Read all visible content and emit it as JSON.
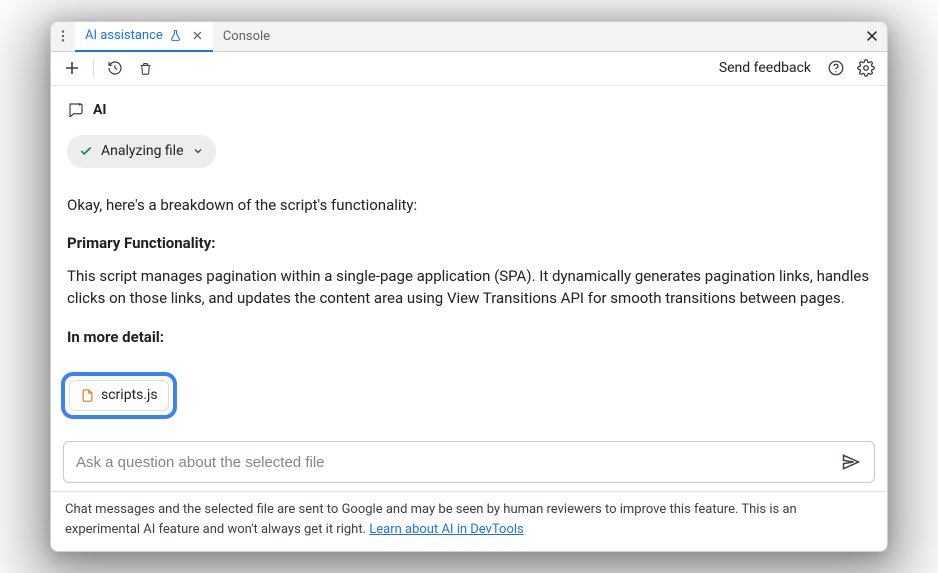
{
  "tabs": {
    "ai_assistance": "AI assistance",
    "console": "Console"
  },
  "toolbar": {
    "send_feedback": "Send feedback"
  },
  "ai": {
    "label": "AI",
    "status": "Analyzing file"
  },
  "response": {
    "intro": "Okay, here's a breakdown of the script's functionality:",
    "primary_title": "Primary Functionality:",
    "primary_body": "This script manages pagination within a single-page application (SPA). It dynamically generates pagination links, handles clicks on those links, and updates the content area using View Transitions API for smooth transitions between pages.",
    "detail_title": "In more detail:"
  },
  "selected_file": {
    "name": "scripts.js"
  },
  "input": {
    "placeholder": "Ask a question about the selected file"
  },
  "footer": {
    "text_before": "Chat messages and the selected file are sent to Google and may be seen by human reviewers to improve this feature. This is an experimental AI feature and won't always get it right. ",
    "link": "Learn about AI in DevTools"
  }
}
